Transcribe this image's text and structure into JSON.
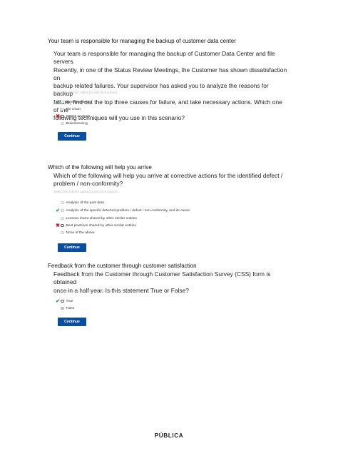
{
  "questions": [
    {
      "title": "Your team is responsible for managing the backup of customer data center",
      "text_lines": [
        "Your team is responsible for managing the backup of Customer Data Center and file servers.",
        "Recently, in one of the Status Review Meetings, the Customer has shown dissatisfaction on",
        "backup related failures. Your supervisor has asked you to analyze the reasons for backup",
        "failure, find out the top three causes for failure, and take necessary actions. Which one of the",
        "following techniques will you use in this scenario?"
      ],
      "hint": "Select the correct option(s) and click submit.",
      "options": [
        {
          "label": "Pareto Analysis",
          "mark": "check",
          "state": "empty"
        },
        {
          "label": "Pie Chart",
          "mark": "none",
          "state": "empty"
        },
        {
          "label": "SWOT Analysis",
          "mark": "cross",
          "state": "selected"
        },
        {
          "label": "Brainstorming",
          "mark": "none",
          "state": "empty"
        }
      ],
      "button": "Continue"
    },
    {
      "title": "Which of the following will help you arrive",
      "text_lines": [
        "Which of the following will help you arrive at corrective actions for the identified defect /",
        "problem / non-conformity?"
      ],
      "hint": "Select the correct option(s) and click submit.",
      "options": [
        {
          "label": "Analysis of the past data",
          "mark": "none",
          "state": "empty"
        },
        {
          "label": "Analysis of the specific detected problem / defect / non-conformity, and its cause",
          "mark": "check",
          "state": "empty"
        },
        {
          "label": "Lessons learnt shared by other similar entities",
          "mark": "none",
          "state": "empty"
        },
        {
          "label": "Best practices shared by other similar entities",
          "mark": "cross",
          "state": "selected"
        },
        {
          "label": "None of the above",
          "mark": "none",
          "state": "empty"
        }
      ],
      "button": "Continue"
    },
    {
      "title": "Feedback from the customer through customer satisfaction",
      "text_lines": [
        "Feedback from the Customer through Customer Satisfaction Survey (CSS) form is obtained",
        "once in a half year. Is this statement True or False?"
      ],
      "hint": "Select the correct option(s) and click submit.",
      "options": [
        {
          "label": "True",
          "mark": "check",
          "state": "selected"
        },
        {
          "label": "False",
          "mark": "none",
          "state": "grey"
        }
      ],
      "button": "Continue"
    }
  ],
  "footer": "PÚBLICA",
  "colors": {
    "button": "#0a4ea3",
    "check": "#1a9e3a",
    "cross": "#d11f1f"
  }
}
